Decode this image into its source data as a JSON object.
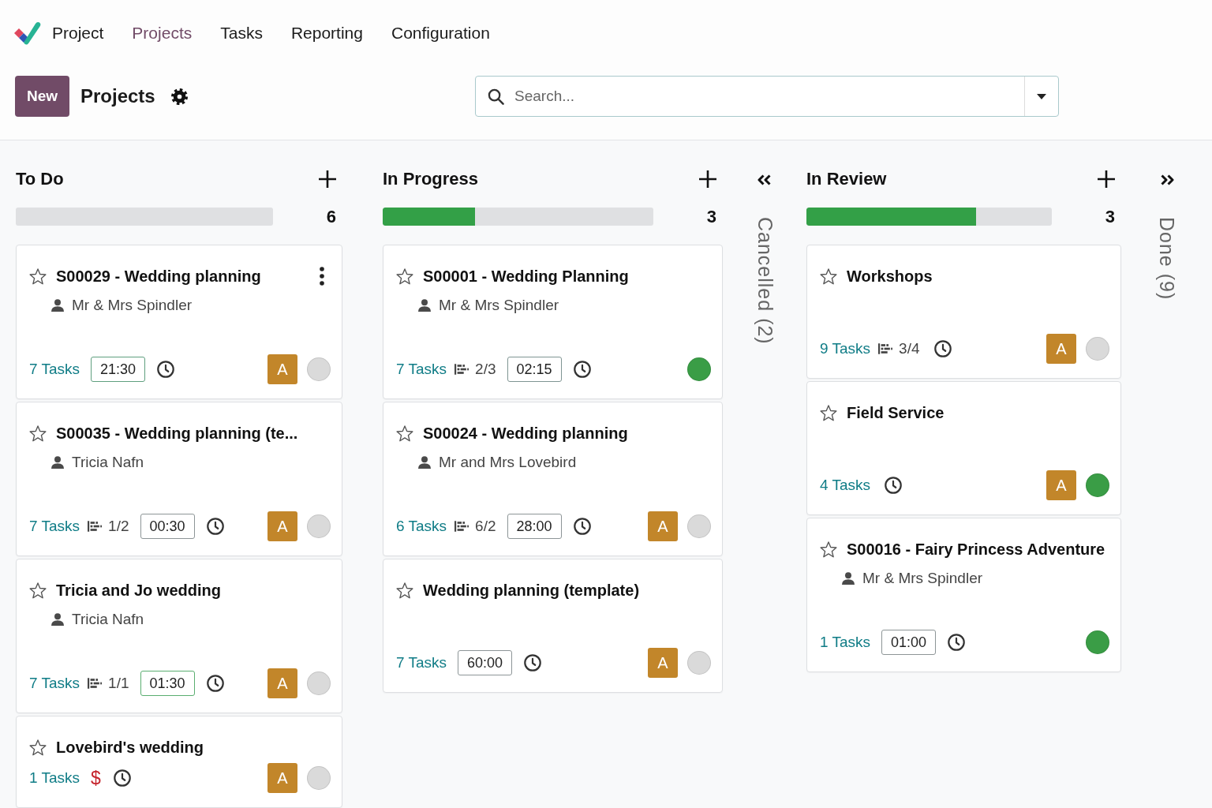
{
  "nav": {
    "app_name": "Project",
    "items": [
      {
        "label": "Projects",
        "selected": true
      },
      {
        "label": "Tasks",
        "selected": false
      },
      {
        "label": "Reporting",
        "selected": false
      },
      {
        "label": "Configuration",
        "selected": false
      }
    ]
  },
  "control_panel": {
    "new_button": "New",
    "title": "Projects",
    "search": {
      "placeholder": "Search..."
    }
  },
  "columns": [
    {
      "kind": "open",
      "title": "To Do",
      "count": "6",
      "cards": [
        {
          "title": "S00029 - Wedding planning",
          "favorite": false,
          "menu_shown": true,
          "customer": "Mr & Mrs Spindler",
          "tasks": "7 Tasks",
          "time": {
            "text": "21:30",
            "color": "#5f9f7f"
          },
          "avatar": "A",
          "status": {
            "color": "#dadada"
          }
        },
        {
          "title": "S00035 - Wedding planning (te...",
          "favorite": false,
          "menu_shown": false,
          "customer": "Tricia Nafn",
          "tasks": "7 Tasks",
          "milestone": "1/2",
          "time": {
            "text": "00:30",
            "color": "#8d9597"
          },
          "avatar": "A",
          "status": {
            "color": "#dadada"
          }
        },
        {
          "title": "Tricia and Jo wedding",
          "favorite": false,
          "menu_shown": false,
          "customer": "Tricia Nafn",
          "tasks": "7 Tasks",
          "milestone": "1/1",
          "time": {
            "text": "01:30",
            "color": "#5aae70"
          },
          "avatar": "A",
          "status": {
            "color": "#dadada"
          }
        },
        {
          "title": "Lovebird's wedding",
          "favorite": false,
          "menu_shown": false,
          "tasks": "1 Tasks",
          "price_symbol": "$",
          "avatar": "A",
          "status": {
            "color": "#dadada"
          }
        }
      ]
    },
    {
      "kind": "open",
      "title": "In Progress",
      "level": 0.34,
      "count": "3",
      "cards": [
        {
          "title": "S00001 - Wedding Planning",
          "favorite": false,
          "menu_shown": false,
          "customer": "Mr & Mrs Spindler",
          "tasks": "7 Tasks",
          "milestone": "2/3",
          "time": {
            "text": "02:15",
            "color": "#7f9593"
          },
          "status": {
            "color": "#3a9d46"
          }
        },
        {
          "title": "S00024 - Wedding planning",
          "favorite": false,
          "menu_shown": false,
          "customer": "Mr and Mrs Lovebird",
          "tasks": "6 Tasks",
          "milestone": "6/2",
          "time": {
            "text": "28:00",
            "color": "#8d9597"
          },
          "avatar": "A",
          "status": {
            "color": "#dadada"
          }
        },
        {
          "title": "Wedding planning (template)",
          "favorite": false,
          "menu_shown": false,
          "tasks": "7 Tasks",
          "time": {
            "text": "60:00",
            "color": "#8d9597"
          },
          "avatar": "A",
          "status": {
            "color": "#dadada"
          }
        }
      ]
    },
    {
      "kind": "folded",
      "title": "Cancelled (2)"
    },
    {
      "kind": "open",
      "title": "In Review",
      "level": 0.69,
      "count": "3",
      "cards": [
        {
          "title": "Workshops",
          "favorite": false,
          "menu_shown": false,
          "tasks": "9 Tasks",
          "milestone": "3/4",
          "avatar": "A",
          "status": {
            "color": "#dadada"
          }
        },
        {
          "title": "Field Service",
          "favorite": false,
          "menu_shown": false,
          "tasks": "4 Tasks",
          "avatar": "A",
          "status": {
            "color": "#3a9d46"
          }
        },
        {
          "title": "S00016 - Fairy Princess Adventure",
          "favorite": false,
          "menu_shown": false,
          "customer": "Mr & Mrs Spindler",
          "tasks": "1 Tasks",
          "time": {
            "text": "01:00",
            "color": "#8d9597"
          },
          "status": {
            "color": "#3a9d46"
          }
        }
      ]
    },
    {
      "kind": "folded",
      "title": "Done (9)"
    }
  ]
}
